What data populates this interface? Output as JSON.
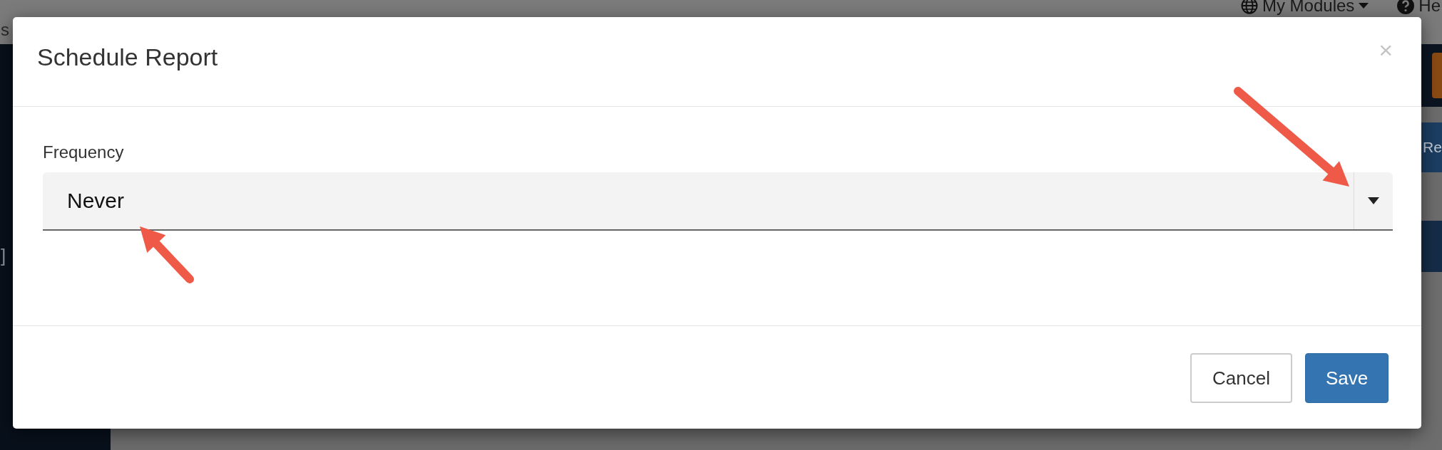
{
  "background": {
    "top_bar": {
      "left_text": "s",
      "menu": "My Modules",
      "help": "He"
    },
    "sidebar_text": "]",
    "side_button": "Re"
  },
  "dialog": {
    "title": "Schedule Report",
    "close": "×",
    "field": {
      "label": "Frequency",
      "value": "Never"
    },
    "buttons": [
      {
        "label": "Cancel",
        "kind": "default"
      },
      {
        "label": "Save",
        "kind": "primary"
      }
    ]
  }
}
